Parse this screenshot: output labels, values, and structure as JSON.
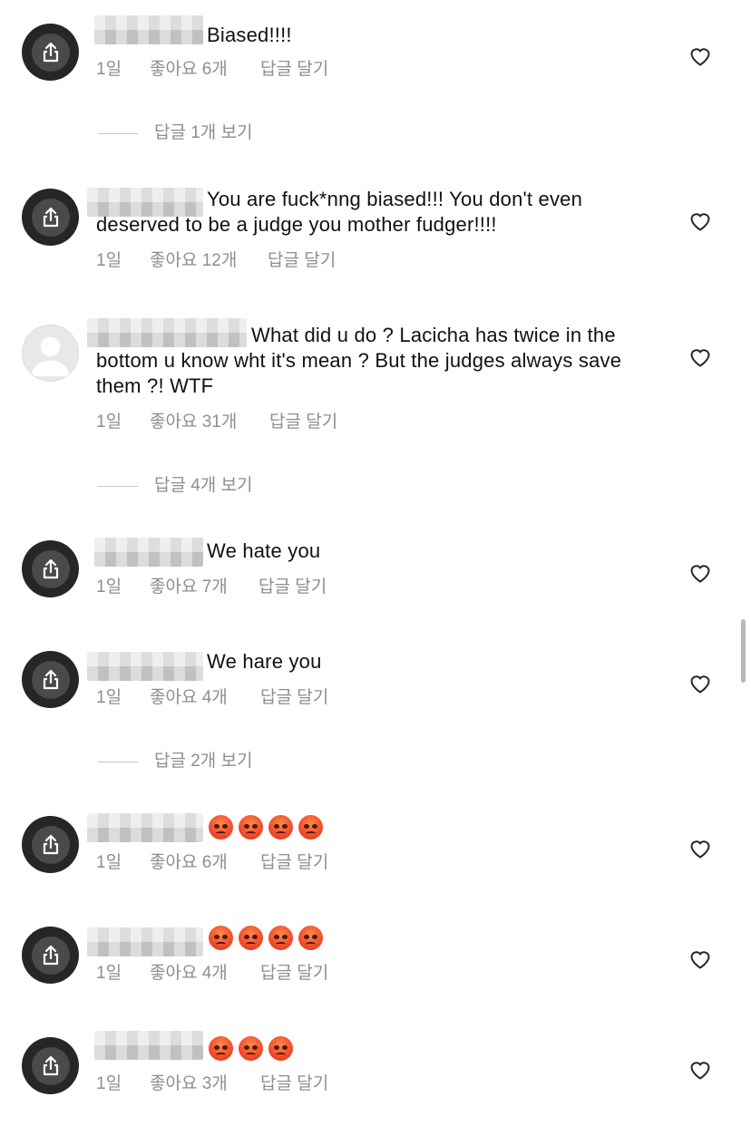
{
  "labels": {
    "time": "1일",
    "reply": "답글 달기"
  },
  "comments": [
    {
      "text": "Biased!!!!",
      "likes": "좋아요 6개"
    },
    {
      "text": "You are fuck*nng biased!!! You don't even deserved to be a judge you mother fudger!!!!",
      "likes": "좋아요 12개"
    },
    {
      "text": "What did u do ? Lacicha has twice in the bottom u know wht it's mean ? But the judges always save them ?! WTF",
      "likes": "좋아요 31개"
    },
    {
      "text": "We hate you",
      "likes": "좋아요 7개"
    },
    {
      "text": "We hare you",
      "likes": "좋아요 4개"
    },
    {
      "text": "",
      "emoji_count": 4,
      "likes": "좋아요 6개"
    },
    {
      "text": "",
      "emoji_count": 4,
      "likes": "좋아요 4개"
    },
    {
      "text": "",
      "emoji_count": 3,
      "likes": "좋아요 3개"
    }
  ],
  "view_replies": [
    "답글 1개 보기",
    "답글 4개 보기",
    "답글 2개 보기"
  ],
  "icons": {
    "avatar": "share-icon",
    "like": "heart-icon",
    "reaction": "angry-face-emoji"
  },
  "colors": {
    "meta": "#8e8e8e",
    "avatar_bg": "#262626",
    "emoji": "#f24a2a"
  }
}
